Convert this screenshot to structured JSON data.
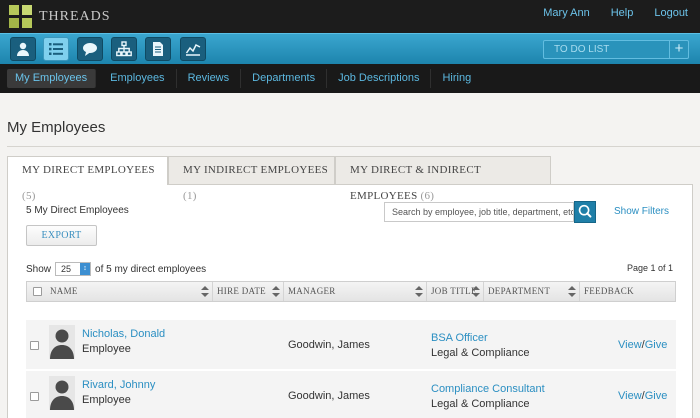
{
  "app": {
    "name": "THREADS"
  },
  "user_nav": {
    "user": "Mary Ann",
    "help": "Help",
    "logout": "Logout"
  },
  "toolbar": {
    "tools": [
      "person-icon",
      "list-icon",
      "chat-bubble-icon",
      "org-chart-icon",
      "document-icon",
      "activity-chart-icon"
    ],
    "active_tool": "list-icon",
    "todo_placeholder": "TO DO LIST",
    "todo_add": "+"
  },
  "subnav": [
    "My Employees",
    "Employees",
    "Reviews",
    "Departments",
    "Job Descriptions",
    "Hiring"
  ],
  "page": {
    "title": "My Employees"
  },
  "tabs": [
    {
      "label": "My Direct Employees",
      "count": "(5)"
    },
    {
      "label": "My Indirect Employees",
      "count": "(1)"
    },
    {
      "label": "My Direct & Indirect Employees",
      "count": "(6)"
    }
  ],
  "summary": {
    "count_label": "5 My Direct Employees",
    "export": "EXPORT"
  },
  "search": {
    "placeholder": "Search by employee, job title, department, etc.",
    "show_filters": "Show Filters"
  },
  "pager": {
    "show": "Show",
    "page_size": "25",
    "of_label": "of 5 my direct employees",
    "page_info": "Page 1 of 1"
  },
  "table": {
    "columns": [
      "NAME",
      "HIRE DATE",
      "MANAGER",
      "JOB TITLE",
      "DEPARTMENT",
      "FEEDBACK"
    ],
    "rows": [
      {
        "name": "Nicholas, Donald",
        "type": "Employee",
        "manager": "Goodwin, James",
        "job_title": "BSA Officer",
        "department": "Legal & Compliance",
        "view": "View",
        "sep": "/",
        "give": "Give"
      },
      {
        "name": "Rivard, Johnny",
        "type": "Employee",
        "manager": "Goodwin, James",
        "job_title": "Compliance Consultant",
        "department": "Legal & Compliance",
        "view": "View",
        "sep": "/",
        "give": "Give"
      }
    ]
  },
  "colors": {
    "accent": "#2b8fc2",
    "toolbar": "#2c97c2",
    "topbar": "#1c1c1c",
    "logo": "#b6c85a"
  }
}
